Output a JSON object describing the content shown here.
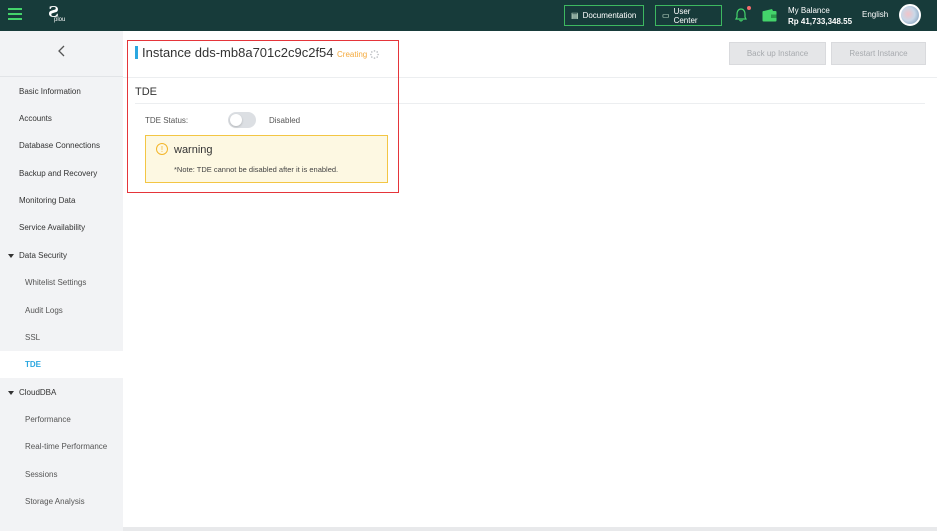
{
  "topbar": {
    "logo_text": "plou",
    "documentation_label": "Documentation",
    "user_center_label": "User Center",
    "balance_label": "My Balance",
    "balance_amount": "Rp 41,733,348.55",
    "language": "English"
  },
  "sidebar": {
    "items": [
      {
        "label": "Basic Information"
      },
      {
        "label": "Accounts"
      },
      {
        "label": "Database Connections"
      },
      {
        "label": "Backup and Recovery"
      },
      {
        "label": "Monitoring Data"
      },
      {
        "label": "Service Availability"
      },
      {
        "label": "Data Security"
      },
      {
        "label": "Whitelist Settings"
      },
      {
        "label": "Audit Logs"
      },
      {
        "label": "SSL"
      },
      {
        "label": "TDE"
      },
      {
        "label": "CloudDBA"
      },
      {
        "label": "Performance"
      },
      {
        "label": "Real-time Performance"
      },
      {
        "label": "Sessions"
      },
      {
        "label": "Storage Analysis"
      }
    ]
  },
  "main": {
    "instance_title": "Instance dds-mb8a701c2c9c2f54",
    "status": "Creating",
    "backup_button": "Back up Instance",
    "restart_button": "Restart Instance",
    "section_title": "TDE",
    "tde_status_label": "TDE Status:",
    "tde_status_value": "Disabled",
    "warning_title": "warning",
    "warning_note": "*Note: TDE cannot be disabled after it is enabled."
  },
  "colors": {
    "topbar": "#173b3a",
    "accent": "#2ba7e0",
    "status": "#f4a93b",
    "highlight": "#e5353a"
  }
}
